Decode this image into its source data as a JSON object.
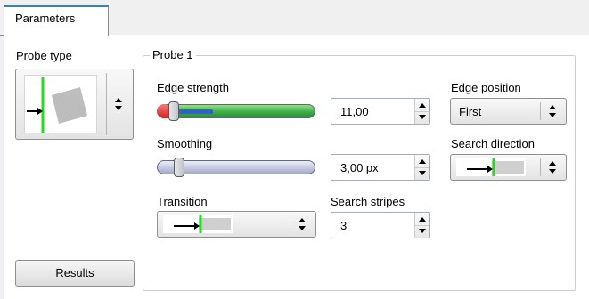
{
  "tabs": [
    {
      "label": "Parameters",
      "active": true
    }
  ],
  "probe_type": {
    "label": "Probe type",
    "icon": "probe-edge-icon"
  },
  "results_button": {
    "label": "Results"
  },
  "probe_group": {
    "title": "Probe 1",
    "edge_strength": {
      "label": "Edge strength",
      "value": "11,00",
      "level": 0.12
    },
    "smoothing": {
      "label": "Smoothing",
      "value": "3,00 px",
      "level": 0.05
    },
    "transition": {
      "label": "Transition",
      "icon": "transition-arrow-icon"
    },
    "search_stripes": {
      "label": "Search stripes",
      "value": "3"
    },
    "edge_position": {
      "label": "Edge position",
      "value": "First"
    },
    "search_direction": {
      "label": "Search direction",
      "icon": "direction-arrow-icon"
    }
  },
  "colors": {
    "tab_accent": "#3c7fb1",
    "edge_strength_track": "#3fb04a",
    "edge_strength_fill": "#2f5fd0",
    "edge_indicator": "#22dd22",
    "smoothing_track": "#c5c8e0"
  }
}
